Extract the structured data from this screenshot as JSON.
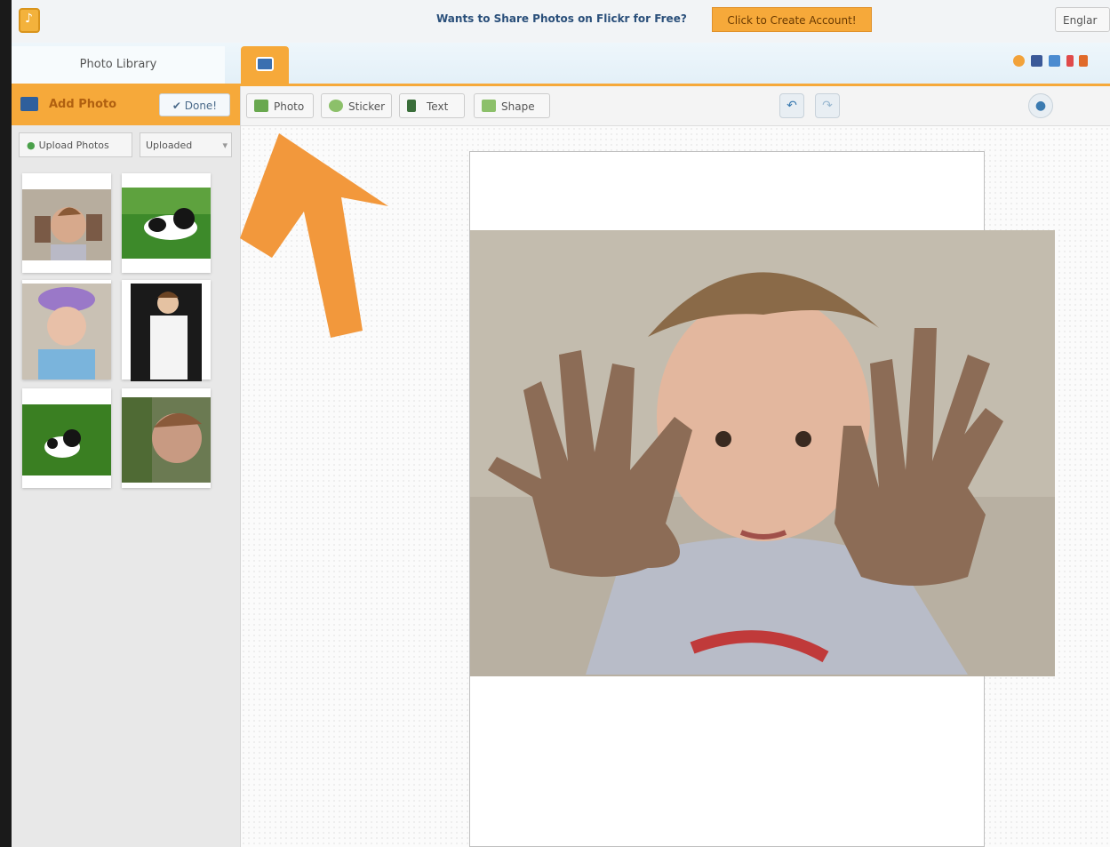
{
  "topbar": {
    "promo_text": "Wants to Share Photos on Flickr for Free?",
    "promo_button": "Click to Create Account!"
  },
  "tabs": {
    "library_label": "Photo Library"
  },
  "sidebar": {
    "add_photo_label": "Add Photo",
    "done_label": "Done!",
    "upload_label": "Upload Photos",
    "filter_value": "Uploaded",
    "thumbnails": [
      "boy-muddy-hands",
      "black-white-dog",
      "child-purple-hat",
      "boy-white-shirt",
      "dog-on-grass",
      "child-close-up"
    ]
  },
  "toolbar": {
    "photo_label": "Photo",
    "sticker_label": "Sticker",
    "text_label": "Text",
    "shape_label": "Shape",
    "language_label": "Englar"
  },
  "colors": {
    "accent": "#f6a93a",
    "brand_blue": "#2a4f7a"
  }
}
